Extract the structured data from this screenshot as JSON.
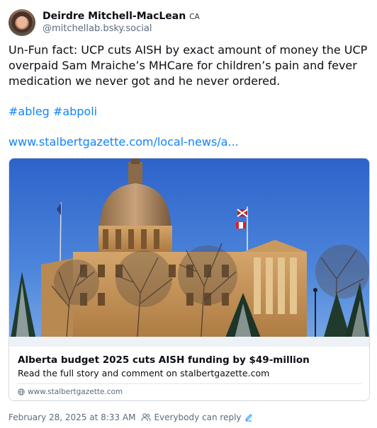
{
  "author": {
    "display_name": "Deirdre Mitchell-MacLean",
    "country_badge": "CA",
    "handle": "@mitchellab.bsky.social"
  },
  "post": {
    "text_line1": "Un-Fun fact: UCP cuts AISH by exact amount of money the UCP",
    "text_line2": "overpaid Sam Mraiche’s MHCare for children’s pain and fever",
    "text_line3": "medication we never got and he never ordered.",
    "hashtag1": "#ableg",
    "hashtag2": "#abpoli",
    "link_text": "www.stalbertgazette.com/local-news/a..."
  },
  "card": {
    "image_icon": "alberta-legislature-photo",
    "title": "Alberta budget 2025 cuts AISH funding by $49-million",
    "description": "Read the full story and comment on stalbertgazette.com",
    "domain": "www.stalbertgazette.com"
  },
  "footer": {
    "timestamp": "February 28, 2025 at 8:33 AM",
    "reply_setting": "Everybody can reply"
  },
  "colors": {
    "link": "#1083fe",
    "muted": "#5b6b7c",
    "text": "#0b0f14"
  }
}
